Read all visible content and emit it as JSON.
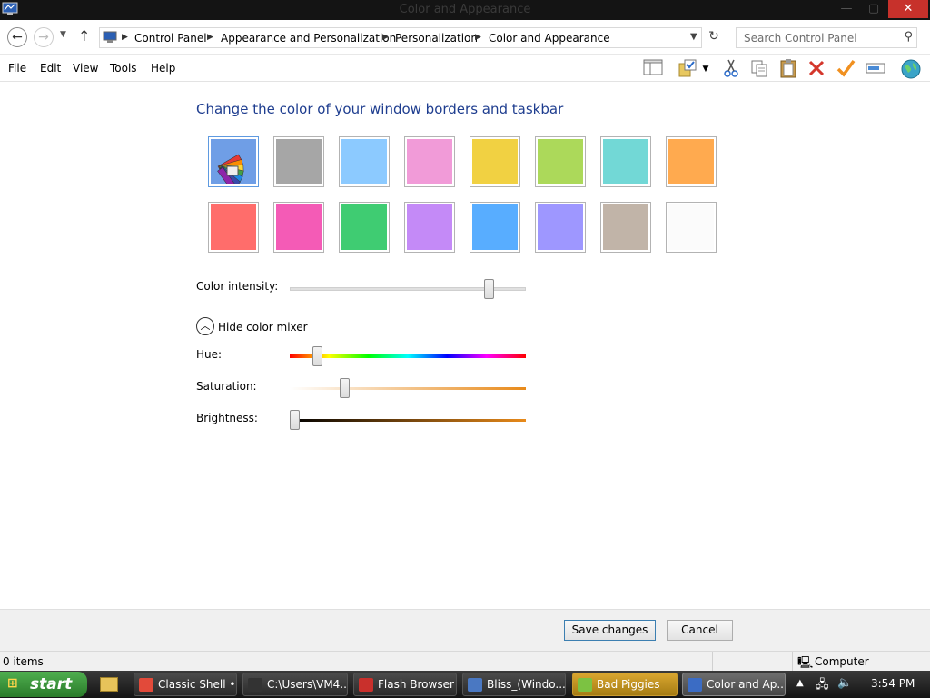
{
  "window": {
    "title": "Color and Appearance",
    "min_glyph": "—",
    "max_glyph": "▢",
    "close_glyph": "✕"
  },
  "address": {
    "breadcrumbs": [
      "Control Panel",
      "Appearance and Personalization",
      "Personalization",
      "Color and Appearance"
    ],
    "search_placeholder": "Search Control Panel"
  },
  "menu": {
    "items": [
      "File",
      "Edit",
      "View",
      "Tools",
      "Help"
    ]
  },
  "toolbar": {
    "icons": [
      "layout-pane-icon",
      "folder-properties-icon",
      "cut-icon",
      "copy-icon",
      "paste-icon",
      "delete-icon",
      "check-icon",
      "rename-icon",
      "globe-icon"
    ]
  },
  "content": {
    "heading": "Change the color of your window borders and taskbar",
    "swatches": [
      {
        "name": "automatic",
        "color": "#6f9ee6",
        "selected": true
      },
      {
        "name": "gray",
        "color": "#a6a6a6"
      },
      {
        "name": "sky-blue",
        "color": "#8ccaff"
      },
      {
        "name": "pink",
        "color": "#f19bd8"
      },
      {
        "name": "yellow",
        "color": "#f1d142"
      },
      {
        "name": "lime",
        "color": "#acd95a"
      },
      {
        "name": "teal",
        "color": "#72d8d6"
      },
      {
        "name": "orange",
        "color": "#ffaa4f"
      },
      {
        "name": "red",
        "color": "#ff6d6b"
      },
      {
        "name": "magenta",
        "color": "#f45bb6"
      },
      {
        "name": "green",
        "color": "#3fcc72"
      },
      {
        "name": "violet",
        "color": "#c48af7"
      },
      {
        "name": "blue",
        "color": "#58adff"
      },
      {
        "name": "periwinkle",
        "color": "#9e97ff"
      },
      {
        "name": "taupe",
        "color": "#c1b4a8"
      },
      {
        "name": "white",
        "color": "#fbfbfb"
      }
    ],
    "color_intensity_label": "Color intensity:",
    "color_intensity_value": 0.86,
    "mixer_toggle_label": "Hide color mixer",
    "hue_label": "Hue:",
    "hue_value": 0.1,
    "saturation_label": "Saturation:",
    "saturation_value": 0.22,
    "brightness_label": "Brightness:",
    "brightness_value": 0.0
  },
  "actions": {
    "save_label": "Save changes",
    "cancel_label": "Cancel"
  },
  "status": {
    "items_count": "0 items",
    "location": "Computer"
  },
  "taskbar": {
    "start_label": "start",
    "tasks": [
      {
        "label": "Classic Shell •...",
        "icon_color": "#e24a3a"
      },
      {
        "label": "C:\\Users\\VM4...",
        "icon_color": "#333333"
      },
      {
        "label": "Flash Browser",
        "icon_color": "#c9302c"
      },
      {
        "label": "Bliss_(Windo...",
        "icon_color": "#4a78c2"
      },
      {
        "label": "Bad Piggies",
        "icon_color": "#7cc242"
      },
      {
        "label": "Color and Ap...",
        "icon_color": "#3b6cc4"
      }
    ],
    "clock": "3:54 PM"
  }
}
